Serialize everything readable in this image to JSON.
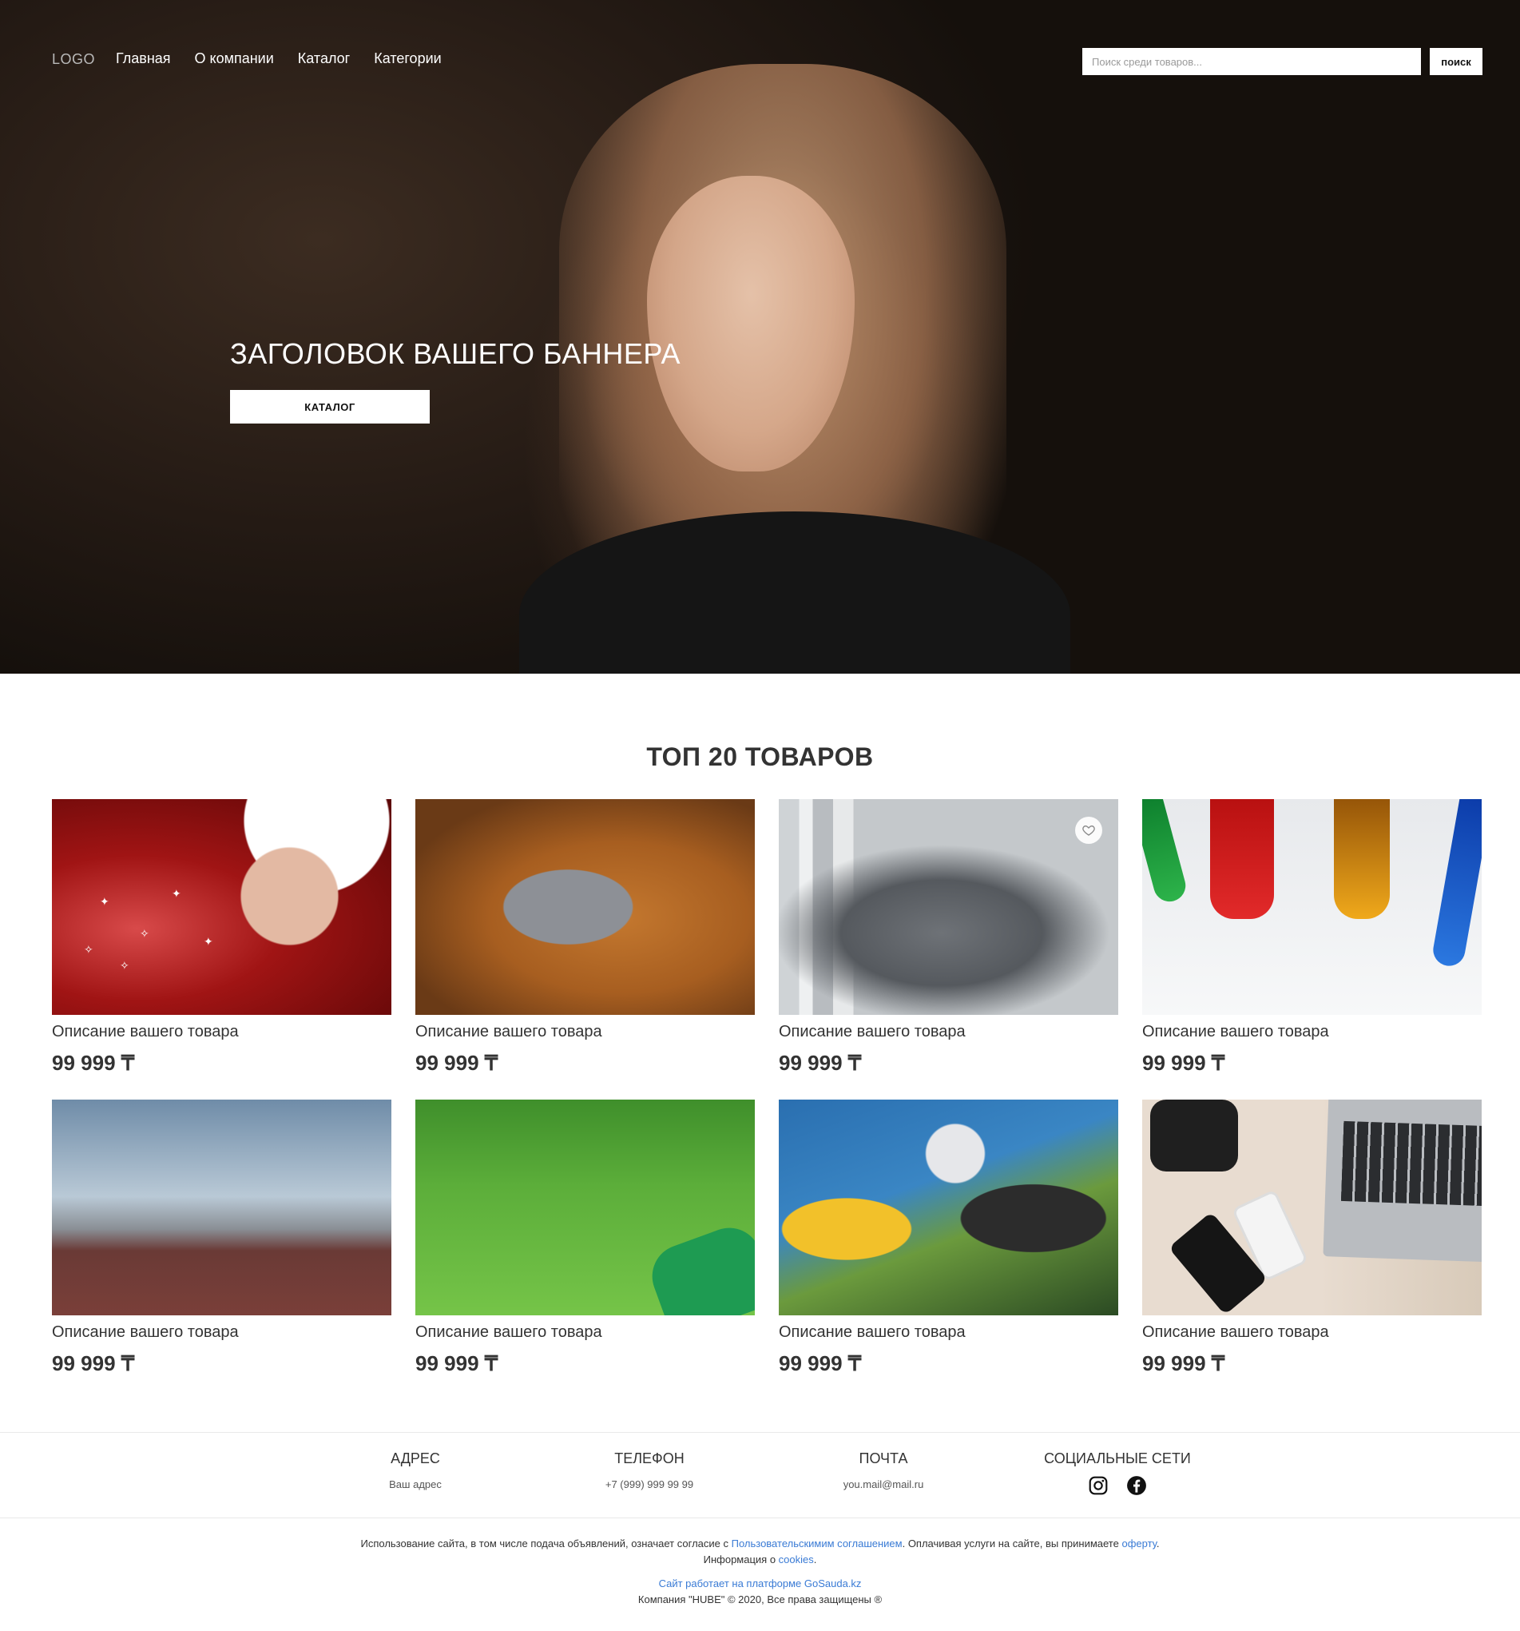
{
  "header": {
    "logo": "LOGO",
    "nav": [
      {
        "label": "Главная"
      },
      {
        "label": "О компании"
      },
      {
        "label": "Каталог"
      },
      {
        "label": "Категории"
      }
    ],
    "search_placeholder": "Поиск среди товаров...",
    "search_button": "поиск"
  },
  "hero": {
    "title": "ЗАГОЛОВОК ВАШЕГО БАННЕРА",
    "button": "КАТАЛОГ"
  },
  "products": {
    "title": "ТОП 20 ТОВАРОВ",
    "items": [
      {
        "title": "Описание вашего товара",
        "price": "99 999 ₸"
      },
      {
        "title": "Описание вашего товара",
        "price": "99 999 ₸"
      },
      {
        "title": "Описание вашего товара",
        "price": "99 999 ₸"
      },
      {
        "title": "Описание вашего товара",
        "price": "99 999 ₸"
      },
      {
        "title": "Описание вашего товара",
        "price": "99 999 ₸"
      },
      {
        "title": "Описание вашего товара",
        "price": "99 999 ₸"
      },
      {
        "title": "Описание вашего товара",
        "price": "99 999 ₸"
      },
      {
        "title": "Описание вашего товара",
        "price": "99 999 ₸"
      }
    ]
  },
  "footer": {
    "address": {
      "heading": "АДРЕС",
      "value": "Ваш адрес"
    },
    "phone": {
      "heading": "ТЕЛЕФОН",
      "value": "+7 (999) 999 99 99"
    },
    "email": {
      "heading": "ПОЧТА",
      "value": "you.mail@mail.ru"
    },
    "social": {
      "heading": "СОЦИАЛЬНЫЕ СЕТИ",
      "icons": [
        "instagram-icon",
        "facebook-icon"
      ]
    },
    "legal": {
      "text1": "Использование сайта, в том числе подача объявлений, означает согласие с ",
      "link_agreement": "Пользовательскимим соглашением",
      "text2": ". Оплачивая услуги на сайте, вы принимаете ",
      "link_offer": "оферту",
      "text3": ".",
      "cookies_prefix": "Информация о ",
      "link_cookies": "cookies",
      "cookies_suffix": ".",
      "platform": "Сайт работает на платформе GoSauda.kz",
      "copyright": "Компания \"HUBE\" © 2020, Все права защищены ®"
    }
  },
  "colors": {
    "link": "#3a7bd5",
    "text": "#333333"
  }
}
